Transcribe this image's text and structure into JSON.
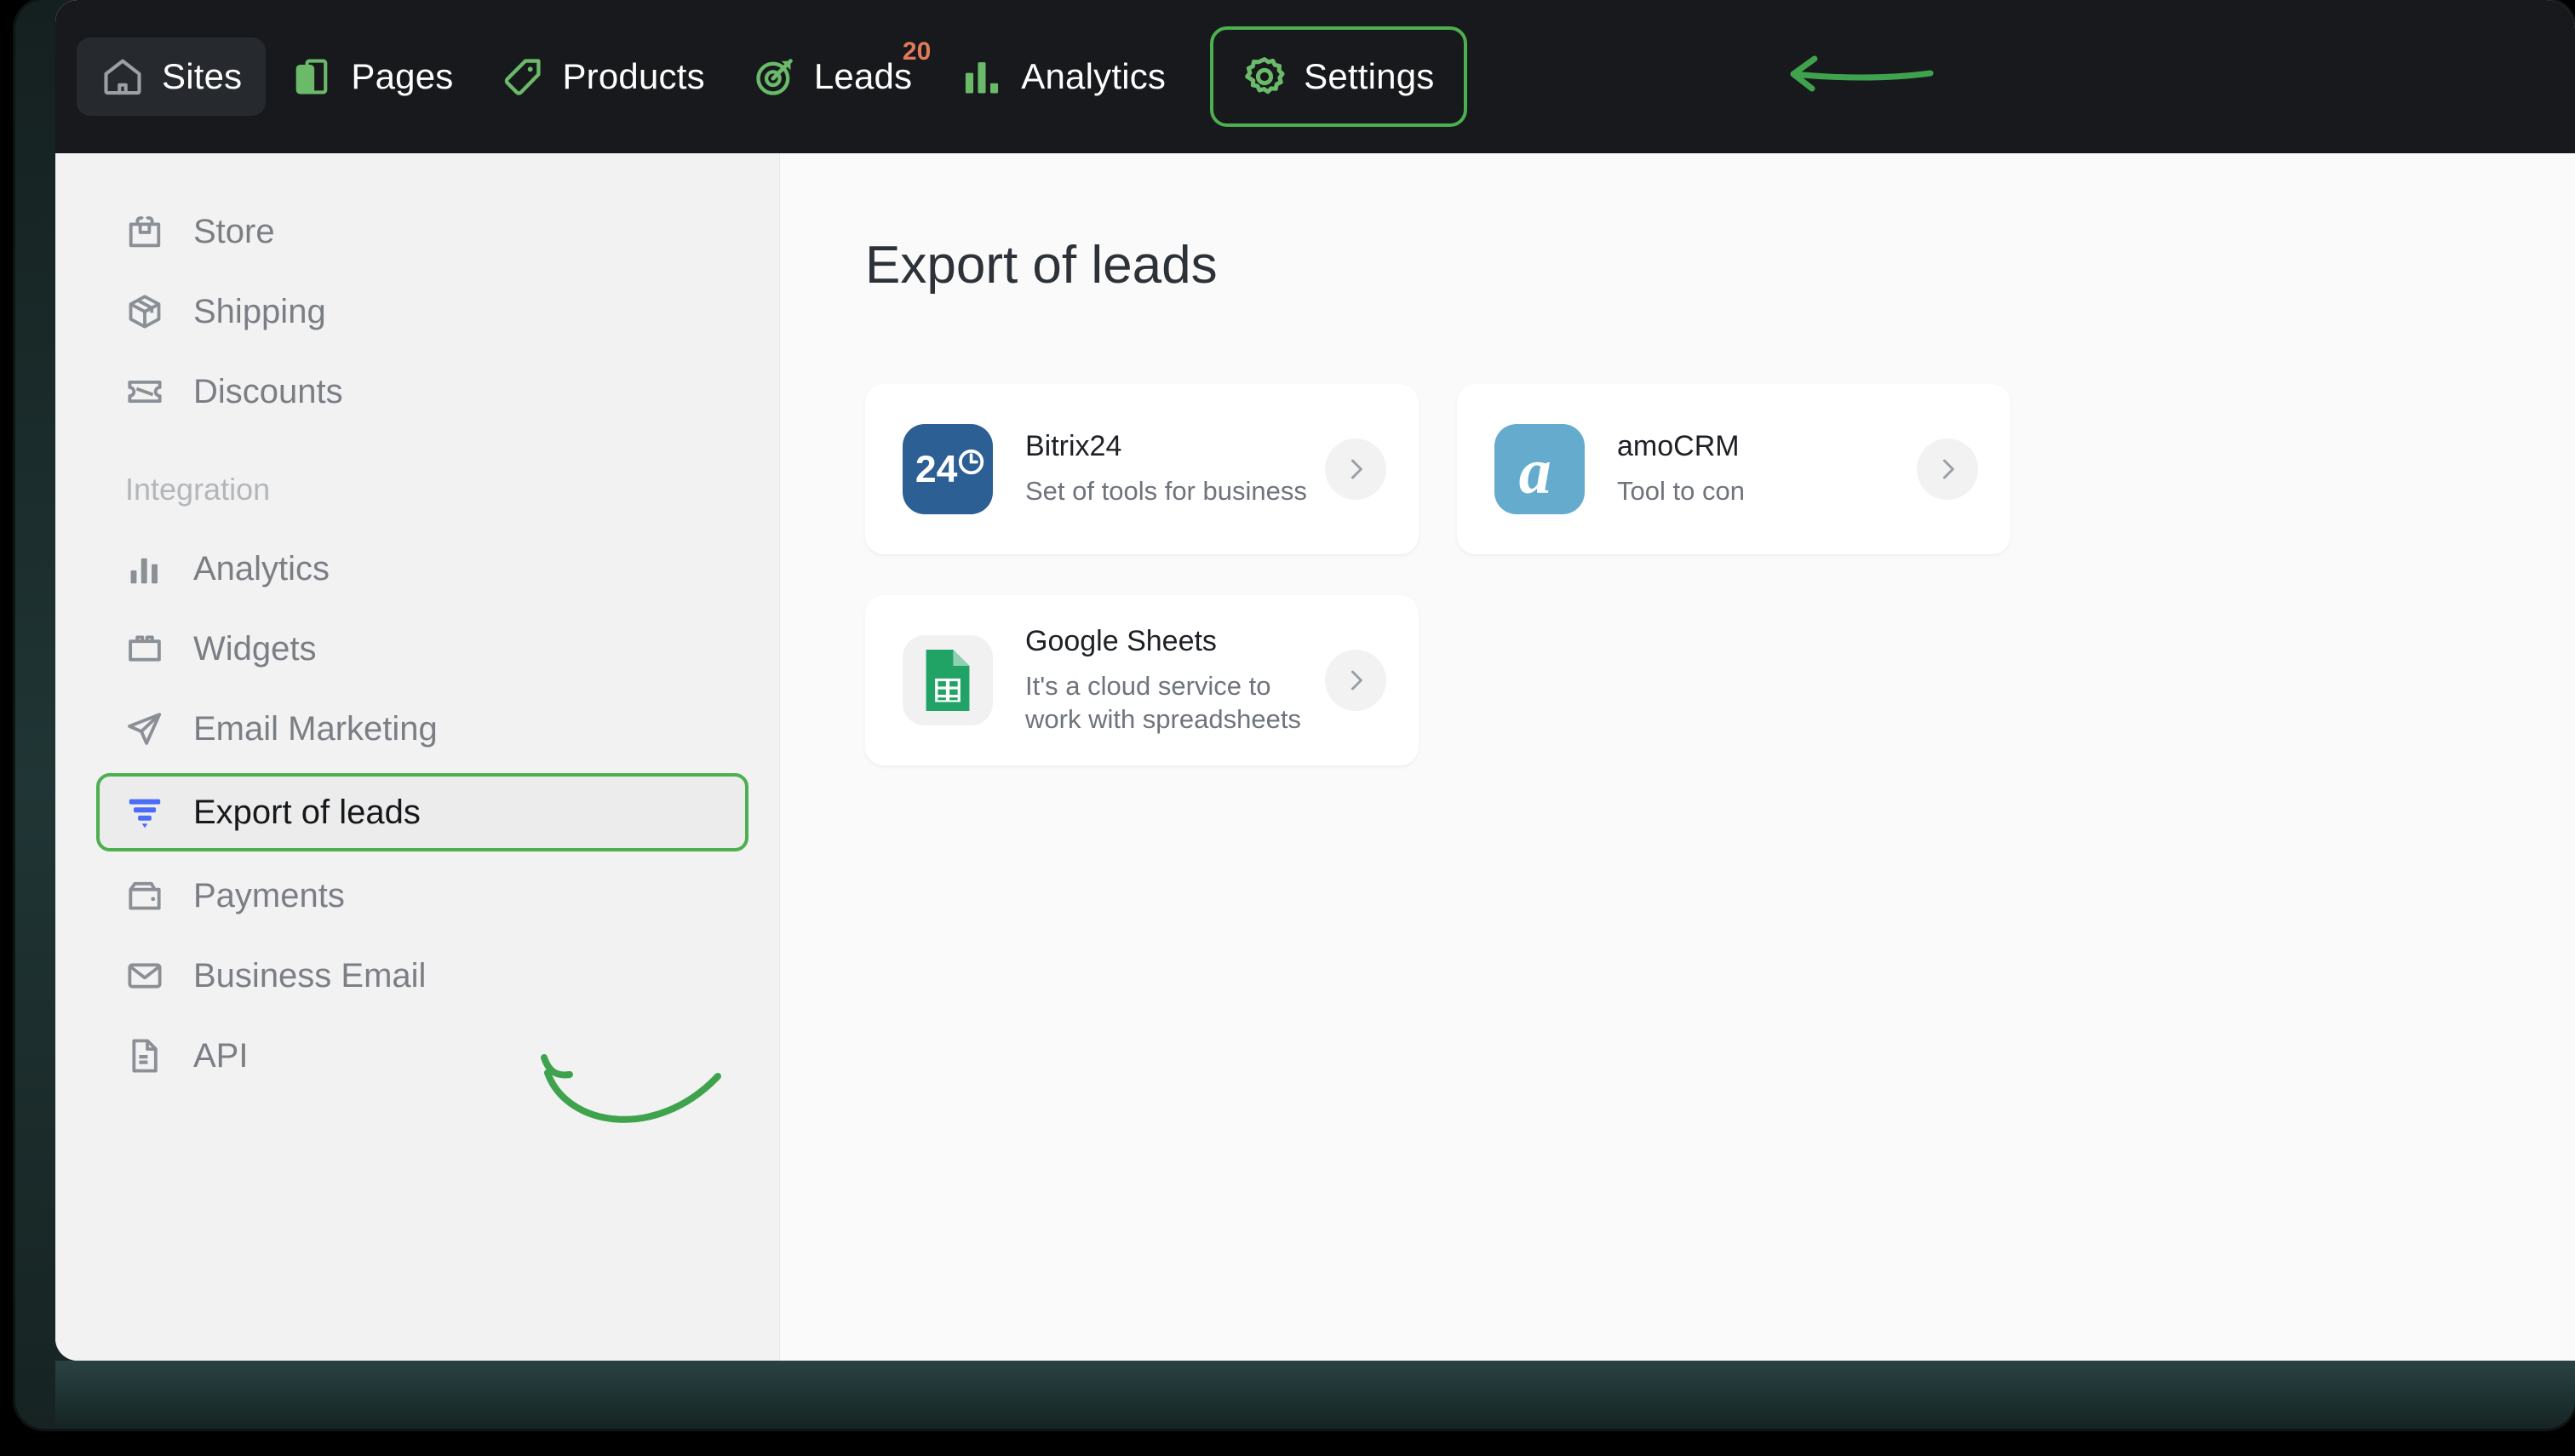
{
  "topnav": {
    "items": [
      {
        "label": "Sites",
        "icon": "home-icon",
        "state": "active",
        "badge": null
      },
      {
        "label": "Pages",
        "icon": "pages-icon",
        "state": "normal",
        "badge": null
      },
      {
        "label": "Products",
        "icon": "tag-icon",
        "state": "normal",
        "badge": null
      },
      {
        "label": "Leads",
        "icon": "target-icon",
        "state": "normal",
        "badge": "20"
      },
      {
        "label": "Analytics",
        "icon": "bar-chart-icon",
        "state": "normal",
        "badge": null
      },
      {
        "label": "Settings",
        "icon": "gear-icon",
        "state": "outlined",
        "badge": null
      }
    ],
    "badge_color": "#e07a5a",
    "accent_color": "#4caf50",
    "background_color": "#17191c"
  },
  "sidebar": {
    "items": [
      {
        "label": "Store",
        "icon": "shopping-bag-icon",
        "selected": false
      },
      {
        "label": "Shipping",
        "icon": "package-icon",
        "selected": false
      },
      {
        "label": "Discounts",
        "icon": "ticket-icon",
        "selected": false
      }
    ],
    "section_label": "Integration",
    "integration_items": [
      {
        "label": "Analytics",
        "icon": "bar-chart-icon",
        "selected": false
      },
      {
        "label": "Widgets",
        "icon": "widget-icon",
        "selected": false
      },
      {
        "label": "Email Marketing",
        "icon": "paper-plane-icon",
        "selected": false
      },
      {
        "label": "Export of leads",
        "icon": "funnel-icon",
        "selected": true
      },
      {
        "label": "Payments",
        "icon": "wallet-icon",
        "selected": false
      },
      {
        "label": "Business Email",
        "icon": "envelope-icon",
        "selected": false
      },
      {
        "label": "API",
        "icon": "document-icon",
        "selected": false
      }
    ],
    "background_color": "#f2f2f2",
    "selected_border_color": "#4caf50",
    "funnel_icon_color": "#4a6cf7"
  },
  "main": {
    "title": "Export of leads",
    "cards": [
      {
        "name": "Bitrix24",
        "description": "Set of tools for business",
        "logo": "bitrix24-logo",
        "logo_text": "24",
        "logo_color": "#2c5f94",
        "chevron": "chevron-right-icon"
      },
      {
        "name": "amoCRM",
        "description": "Tool to con",
        "logo": "amocrm-logo",
        "logo_text": "a",
        "logo_color": "#64abcd",
        "chevron": "chevron-right-icon"
      },
      {
        "name": "Google Sheets",
        "description": "It's a cloud service to work with spreadsheets",
        "logo": "google-sheets-logo",
        "logo_text": "",
        "logo_color": "#21a366",
        "chevron": "chevron-right-icon"
      }
    ]
  },
  "annotations": {
    "settings_arrow": "left-pointing-arrow",
    "export_arrow": "curved-up-left-arrow",
    "color": "#4caf50"
  }
}
